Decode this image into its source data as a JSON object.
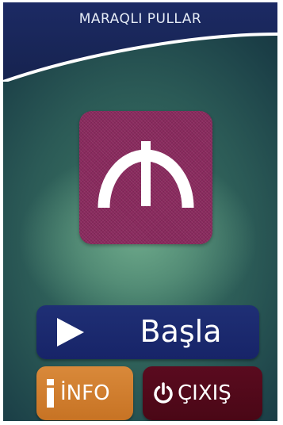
{
  "app": {
    "title": "MARAQLI PULLAR"
  },
  "logo": {
    "icon": "manat-symbol-icon",
    "background": "#8a2a5e"
  },
  "buttons": {
    "start": {
      "label": "Başla",
      "icon": "play-icon",
      "color": "#1f2f75"
    },
    "info": {
      "label": "İNFO",
      "icon": "info-icon",
      "color": "#d9893a"
    },
    "exit": {
      "label": "ÇIXIŞ",
      "icon": "power-icon",
      "color": "#5a0b1f"
    }
  }
}
